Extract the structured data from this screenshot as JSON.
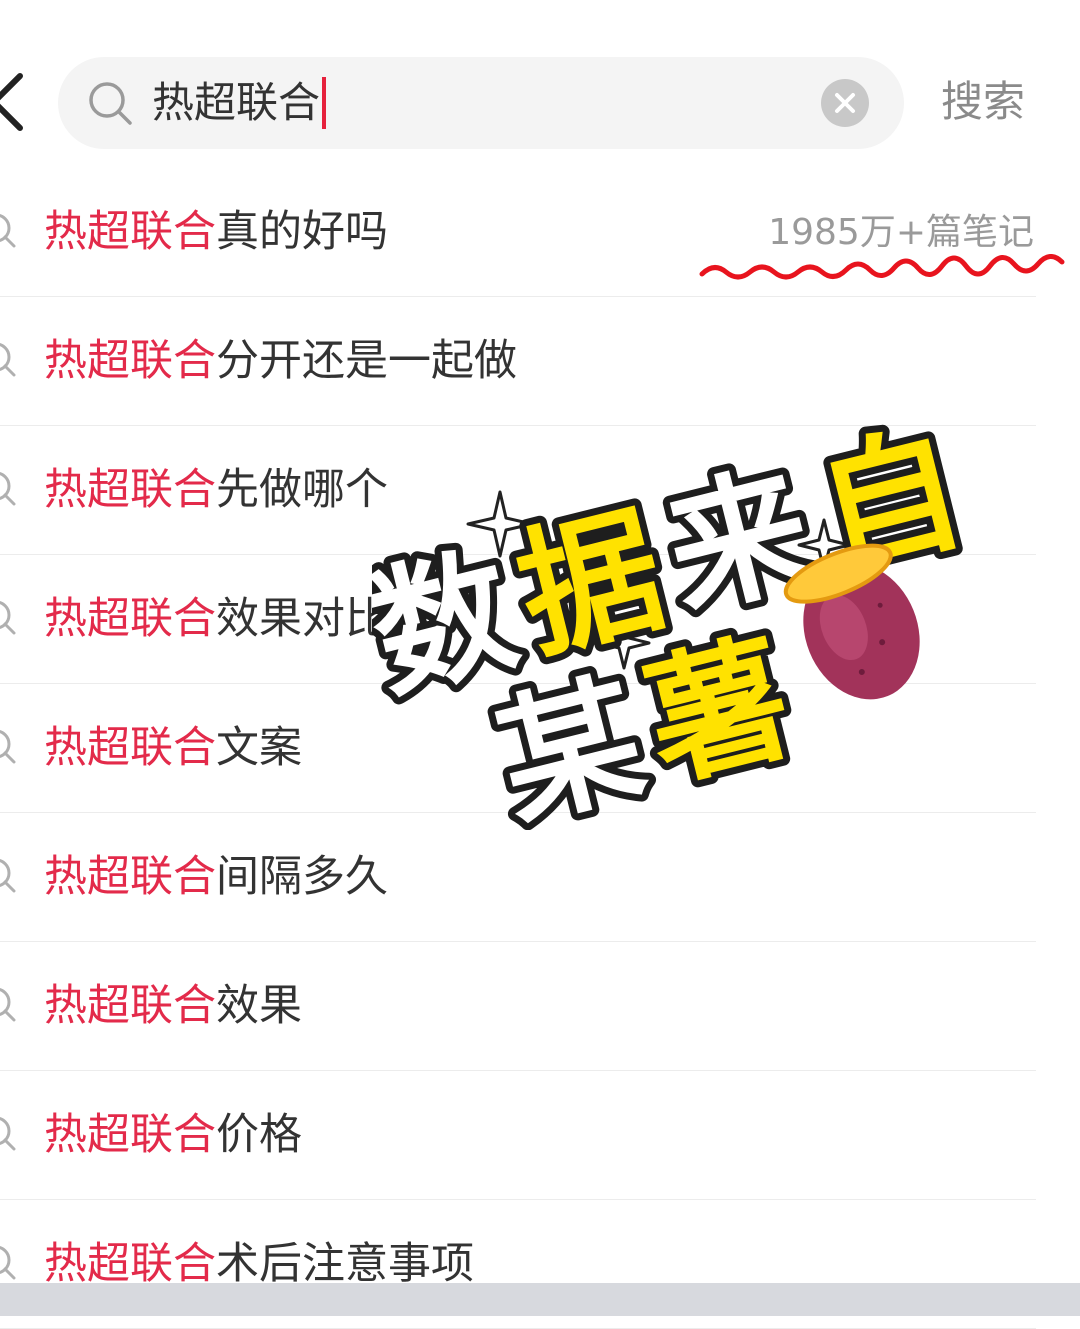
{
  "header": {
    "back_icon": "chevron-left-icon",
    "search_query": "热超联合",
    "search_icon": "search-icon",
    "clear_icon": "close-icon",
    "submit_label": "搜索"
  },
  "suggestions": [
    {
      "highlight": "热超联合",
      "rest": "真的好吗",
      "count": "1985万+篇笔记"
    },
    {
      "highlight": "热超联合",
      "rest": "分开还是一起做"
    },
    {
      "highlight": "热超联合",
      "rest": "先做哪个"
    },
    {
      "highlight": "热超联合",
      "rest": "效果对比"
    },
    {
      "highlight": "热超联合",
      "rest": "文案"
    },
    {
      "highlight": "热超联合",
      "rest": "间隔多久"
    },
    {
      "highlight": "热超联合",
      "rest": "效果"
    },
    {
      "highlight": "热超联合",
      "rest": "价格"
    },
    {
      "highlight": "热超联合",
      "rest": "术后注意事项"
    }
  ],
  "watermark": {
    "line1": [
      "数",
      "据",
      "来",
      "自"
    ],
    "line2": [
      "某",
      "薯"
    ],
    "emoji": "sweet-potato-icon"
  },
  "colors": {
    "highlight": "#e32a4a",
    "caret": "#e6213c",
    "watermark_yellow": "#ffe200",
    "squiggle": "#e8141e"
  }
}
